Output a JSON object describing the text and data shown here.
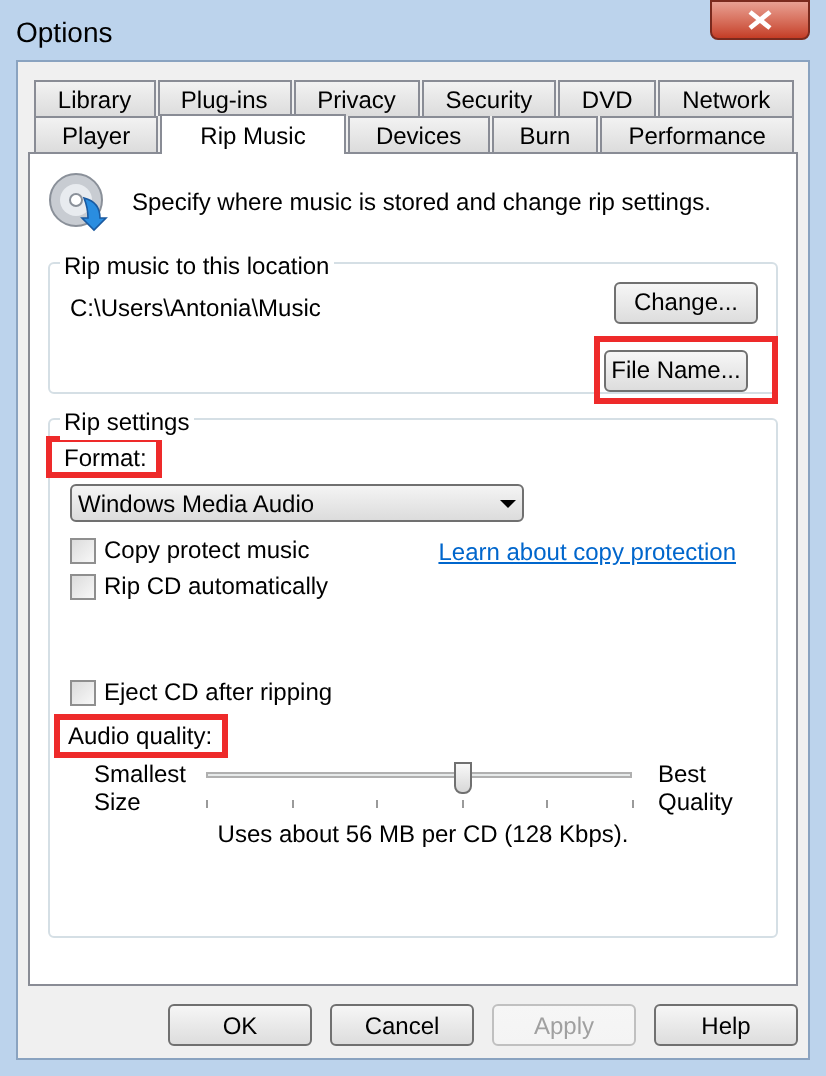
{
  "window": {
    "title": "Options"
  },
  "tab_rows": [
    [
      {
        "label": "Library",
        "selected": false
      },
      {
        "label": "Plug-ins",
        "selected": false
      },
      {
        "label": "Privacy",
        "selected": false
      },
      {
        "label": "Security",
        "selected": false
      },
      {
        "label": "DVD",
        "selected": false
      },
      {
        "label": "Network",
        "selected": false
      }
    ],
    [
      {
        "label": "Player",
        "selected": false
      },
      {
        "label": "Rip Music",
        "selected": true
      },
      {
        "label": "Devices",
        "selected": false
      },
      {
        "label": "Burn",
        "selected": false
      },
      {
        "label": "Performance",
        "selected": false
      }
    ]
  ],
  "intro": "Specify where music is stored and change rip settings.",
  "location_group": {
    "title": "Rip music to this location",
    "path": "C:\\Users\\Antonia\\Music",
    "buttons": [
      {
        "label": "Change...",
        "highlighted": false
      },
      {
        "label": "File Name...",
        "highlighted": true
      }
    ]
  },
  "rip_settings": {
    "title": "Rip settings",
    "format_label": {
      "text": "Format:",
      "highlighted": true
    },
    "format_value": "Windows Media Audio",
    "options": [
      {
        "label": "Copy protect music",
        "checked": false
      },
      {
        "label": "Rip CD automatically",
        "checked": false
      }
    ],
    "link": "Learn about copy protection",
    "eject": {
      "label": "Eject CD after ripping",
      "checked": false
    },
    "quality_label": {
      "text": "Audio quality:",
      "highlighted": true
    },
    "slider": {
      "min_label": [
        "Smallest",
        "Size"
      ],
      "max_label": [
        "Best",
        "Quality"
      ],
      "level": 0.6
    },
    "usage": "Uses about 56 MB per CD (128 Kbps)."
  },
  "buttons": [
    {
      "label": "OK",
      "disabled": false
    },
    {
      "label": "Cancel",
      "disabled": false
    },
    {
      "label": "Apply",
      "disabled": true
    },
    {
      "label": "Help",
      "disabled": false
    }
  ]
}
